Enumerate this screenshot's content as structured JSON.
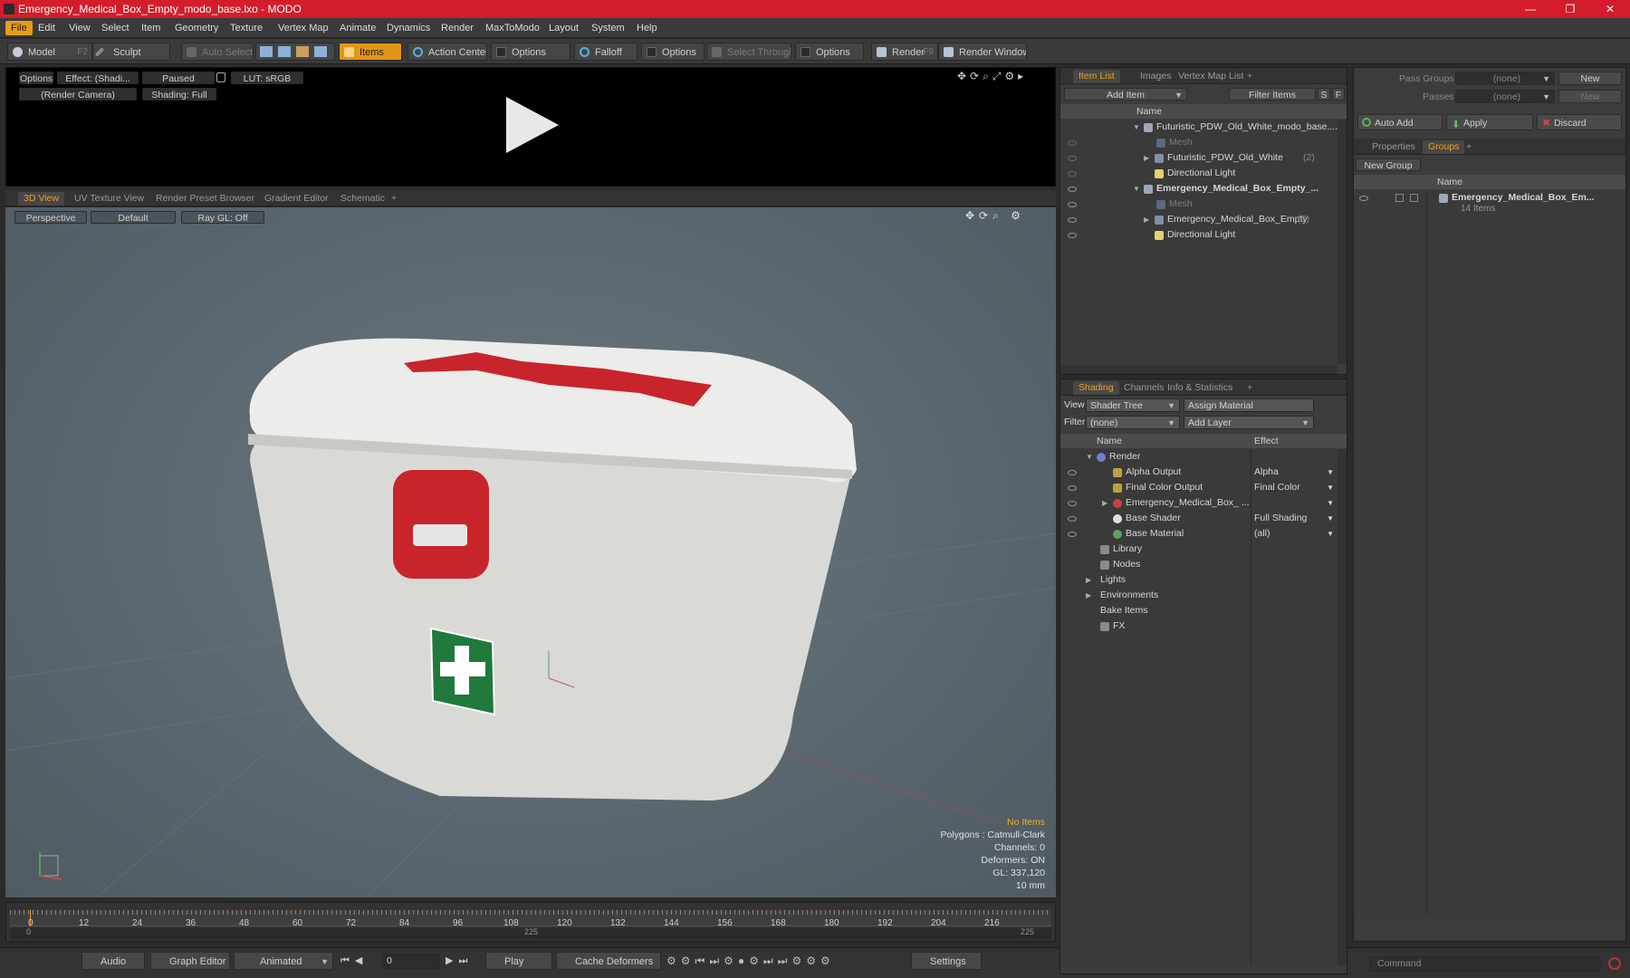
{
  "window": {
    "title": "Emergency_Medical_Box_Empty_modo_base.lxo - MODO",
    "minimize": "—",
    "maximize": "❐",
    "close": "✕"
  },
  "menu": [
    "File",
    "Edit",
    "View",
    "Select",
    "Item",
    "Geometry",
    "Texture",
    "Vertex Map",
    "Animate",
    "Dynamics",
    "Render",
    "MaxToModo",
    "Layout",
    "System",
    "Help"
  ],
  "toolbar": {
    "model": "Model",
    "model_key": "F2",
    "sculpt": "Sculpt",
    "auto_select": "Auto Select",
    "items": "Items",
    "action_center": "Action Center",
    "options1": "Options",
    "falloff": "Falloff",
    "options2": "Options",
    "select_through": "Select Through",
    "options3": "Options",
    "render": "Render",
    "render_key": "F9",
    "render_window": "Render Window"
  },
  "preview": {
    "options": "Options",
    "effect": "Effect: (Shadi...",
    "paused": "Paused",
    "lut": "LUT: sRGB",
    "camera": "(Render Camera)",
    "shading": "Shading: Full"
  },
  "viewport": {
    "tabs": [
      "3D View",
      "UV Texture View",
      "Render Preset Browser",
      "Gradient Editor",
      "Schematic",
      "+"
    ],
    "perspective": "Perspective",
    "default": "Default",
    "raygl": "Ray GL: Off",
    "status": {
      "items": "No Items",
      "polygons": "Polygons : Catmull-Clark",
      "channels": "Channels: 0",
      "deformers": "Deformers: ON",
      "gl": "GL: 337,120",
      "scale": "10 mm"
    },
    "colors": {
      "background": "#5d6a72",
      "box": "#e6e6e4",
      "red": "#c8242b",
      "cross": "#1f7a3c"
    }
  },
  "item_list": {
    "tabs": [
      "Item List",
      "Images",
      "Vertex Map List",
      "+"
    ],
    "add_item": "Add Item",
    "filter": "Filter Items",
    "s": "S",
    "f": "F",
    "col_name": "Name",
    "rows": [
      {
        "label": "Futuristic_PDW_Old_White_modo_base....",
        "bold": false
      },
      {
        "label": "Mesh",
        "bold": false
      },
      {
        "label": "Futuristic_PDW_Old_White",
        "count": "(2)",
        "bold": false
      },
      {
        "label": "Directional Light",
        "bold": false
      },
      {
        "label": "Emergency_Medical_Box_Empty_...",
        "bold": true
      },
      {
        "label": "Mesh",
        "bold": false
      },
      {
        "label": "Emergency_Medical_Box_Empty",
        "count": "(2)",
        "bold": false
      },
      {
        "label": "Directional Light",
        "bold": false
      }
    ]
  },
  "shading": {
    "tabs": [
      "Shading",
      "Channels",
      "Info & Statistics",
      "+"
    ],
    "view_label": "View",
    "view_value": "Shader Tree",
    "assign": "Assign Material",
    "filter_label": "Filter",
    "filter_value": "(none)",
    "add_layer": "Add Layer",
    "col_name": "Name",
    "col_effect": "Effect",
    "rows": [
      {
        "label": "Render",
        "effect": ""
      },
      {
        "label": "Alpha Output",
        "effect": "Alpha"
      },
      {
        "label": "Final Color Output",
        "effect": "Final Color"
      },
      {
        "label": "Emergency_Medical_Box_ ...",
        "effect": ""
      },
      {
        "label": "Base Shader",
        "effect": "Full Shading"
      },
      {
        "label": "Base Material",
        "effect": "(all)"
      },
      {
        "label": "Library",
        "effect": ""
      },
      {
        "label": "Nodes",
        "effect": ""
      },
      {
        "label": "Lights",
        "effect": ""
      },
      {
        "label": "Environments",
        "effect": ""
      },
      {
        "label": "Bake Items",
        "effect": ""
      },
      {
        "label": "FX",
        "effect": ""
      }
    ]
  },
  "groups": {
    "pass_groups": "Pass Groups",
    "passes": "Passes",
    "none": "(none)",
    "new": "New",
    "auto_add": "Auto Add",
    "apply": "Apply",
    "discard": "Discard",
    "tabs": [
      "Properties",
      "Groups",
      "+"
    ],
    "new_group": "New Group",
    "col_name": "Name",
    "group_name": "Emergency_Medical_Box_Em...",
    "group_count": "14 Items"
  },
  "timeline": {
    "ticks": [
      "0",
      "12",
      "24",
      "36",
      "48",
      "60",
      "72",
      "84",
      "96",
      "108",
      "120",
      "132",
      "144",
      "156",
      "168",
      "180",
      "192",
      "204",
      "216"
    ],
    "start": "0",
    "mid": "225",
    "end": "225"
  },
  "bottom": {
    "audio": "Audio",
    "graph_editor": "Graph Editor",
    "animated": "Animated",
    "frame": "0",
    "play": "Play",
    "cache": "Cache Deformers",
    "settings": "Settings",
    "command": "Command"
  }
}
